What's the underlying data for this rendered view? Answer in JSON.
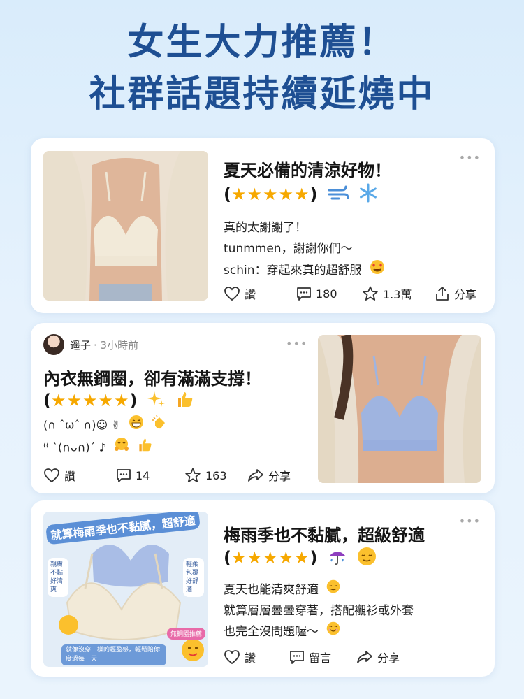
{
  "headline": {
    "line1": "女生大力推薦！",
    "line2": "社群話題持續延燒中"
  },
  "card1": {
    "title": "夏天必備的清涼好物！",
    "stars": "★★★★★",
    "lines": [
      "真的太謝謝了！",
      "tunmmen，謝謝你們～",
      "schin：穿起來真的超舒服"
    ],
    "actions": {
      "like": "讚",
      "comments": "180",
      "stars": "1.3萬",
      "share": "分享"
    }
  },
  "card2": {
    "username": "遥子",
    "time": "· 3小時前",
    "title": "內衣無鋼圈，卻有滿滿支撐！",
    "stars": "★★★★★",
    "kaomoji1": "(∩ ˆωˆ ∩)☺ ✌",
    "kaomoji2": "⁽⁽ ˋ(∩ᴗ∩)ˊ ♪",
    "actions": {
      "like": "讚",
      "comments": "14",
      "stars": "163",
      "share": "分享"
    }
  },
  "card3": {
    "banner": "就算梅雨季也不黏膩，超舒適",
    "side_left": "親膚不黏好清爽",
    "side_right": "輕柔包覆好舒適",
    "bottom_caption": "就像沒穿一樣的輕盈感，輕鬆陪你度過每一天",
    "badge": "無鋼圈推薦",
    "title": "梅雨季也不黏膩，超級舒適",
    "stars": "★★★★★",
    "lines": [
      "夏天也能清爽舒適",
      "就算層層疊疊穿著，搭配襯衫或外套",
      "也完全沒問題喔～"
    ],
    "actions": {
      "like": "讚",
      "comment": "留言",
      "share": "分享"
    }
  },
  "colors": {
    "headline": "#1e4f93",
    "star": "#f6a800",
    "background": "#dfeefc"
  },
  "icons": [
    "heart-icon",
    "comment-icon",
    "star-outline-icon",
    "share-icon",
    "more-dots-icon"
  ]
}
